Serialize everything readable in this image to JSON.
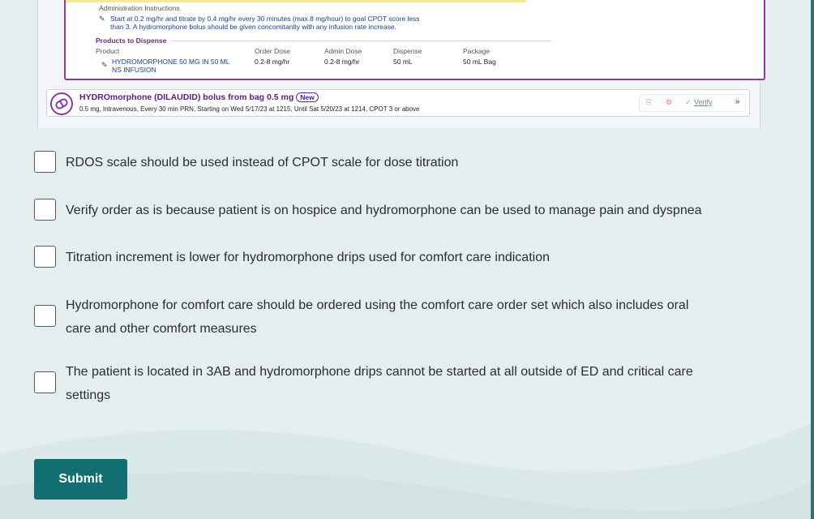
{
  "colors": {
    "accent": "#136e72",
    "order_border": "#8a3aa8",
    "background": "#e4eeee"
  },
  "order_panel": {
    "admin_instructions_label": "Administration Instructions",
    "admin_instructions_line1": "Start at 0.2 mg/hr and titrate by 0.4 mg/hr every 30 minutes (max 8 mg/hour) to goal CPOT score less",
    "admin_instructions_line2": "than 3. A hydromorphone bolus should be given concomitantly with any infusion rate increase.",
    "products_label": "Products to Dispense",
    "columns": {
      "product": "Product",
      "order_dose": "Order Dose",
      "admin_dose": "Admin Dose",
      "dispense": "Dispense",
      "package": "Package"
    },
    "row": {
      "product_line1": "HYDROMORPHONE 50 MG IN 50 ML",
      "product_line2": "NS INFUSION",
      "order_dose": "0.2-8 mg/hr",
      "admin_dose": "0.2-8 mg/hr",
      "dispense": "50 mL",
      "package": "50 mL Bag"
    },
    "bolus": {
      "title": "HYDROmorphone (DILAUDID) bolus from bag 0.5 mg",
      "badge": "New",
      "details": "0.5 mg, Intravenous, Every 30 min PRN, Starting on Wed 5/17/23 at 1215, Until Sat 5/20/23 at 1214, CPOT 3 or above",
      "verify_label": "Verify",
      "icons": [
        "pill-icon",
        "copy-icon",
        "settings-icon",
        "check-icon",
        "double-chevron-icon"
      ]
    }
  },
  "options": [
    {
      "line1": "RDOS scale should be used instead of CPOT scale for dose titration",
      "line2": ""
    },
    {
      "line1": "Verify order as is because patient is on hospice and hydromorphone can be used to manage pain and dyspnea",
      "line2": ""
    },
    {
      "line1": "Titration increment is lower for hydromorphone drips used for comfort care indication",
      "line2": ""
    },
    {
      "line1": "Hydromorphone for comfort care should be ordered using the comfort care order set which also includes oral",
      "line2": "care and other comfort measures"
    },
    {
      "line1": "The patient is located in 3AB and hydromorphone drips cannot be started at all outside of ED and critical care",
      "line2": "settings"
    }
  ],
  "submit_label": "Submit"
}
